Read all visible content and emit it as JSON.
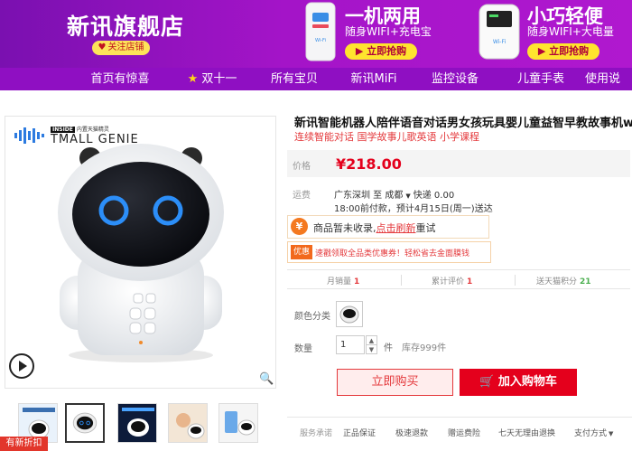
{
  "header": {
    "store_name": "新讯旗舰店",
    "follow_label": "关注店铺",
    "promos": [
      {
        "title": "一机两用",
        "subtitle": "随身WIFI+充电宝",
        "button": "立即抢购"
      },
      {
        "title": "小巧轻便",
        "subtitle": "随身WIFI+大电量",
        "button": "立即抢购"
      }
    ]
  },
  "nav": {
    "items": [
      "首页有惊喜",
      "双十一",
      "所有宝贝",
      "新讯MiFi",
      "监控设备",
      "儿童手表",
      "使用说"
    ]
  },
  "gallery": {
    "inside_label": "INSIDE",
    "inside_text": "内置天猫精灵",
    "brand": "TMALL GENIE",
    "new_tag": "有新折扣"
  },
  "product": {
    "name": "新讯智能机器人陪伴语音对话男女孩玩具婴儿童益智早教故事机wifi",
    "desc": "连续智能对话 国学故事儿歌英语 小学课程",
    "price_label": "价格",
    "price": "¥218.00",
    "shipping_label": "运费",
    "shipping_route": "广东深圳 至 成都",
    "shipping_type": "快递 0.00",
    "delivery": "18:00前付款，预计4月15日(周一)送达",
    "notice_text": "商品暂未收录,",
    "notice_link": "点击刷新",
    "notice_tail": "重试",
    "coupon_tag": "优惠",
    "coupon_text": "速戳领取全品类优惠券！轻松省去金面膜钱",
    "stats": [
      {
        "label": "月销量",
        "value": "1"
      },
      {
        "label": "累计评价",
        "value": "1"
      },
      {
        "label": "送天猫积分",
        "value": "21"
      }
    ],
    "color_label": "颜色分类",
    "qty_label": "数量",
    "qty_value": "1",
    "qty_unit": "件",
    "stock": "库存999件",
    "buy_label": "立即购买",
    "cart_label": "加入购物车",
    "promise_label": "服务承诺",
    "promises": [
      "正品保证",
      "极速退款",
      "赠运费险",
      "七天无理由退换",
      "支付方式"
    ]
  },
  "colors": {
    "purple": "#9b14c6",
    "price_red": "#e4001c",
    "accent_yellow": "#ffe42e"
  }
}
